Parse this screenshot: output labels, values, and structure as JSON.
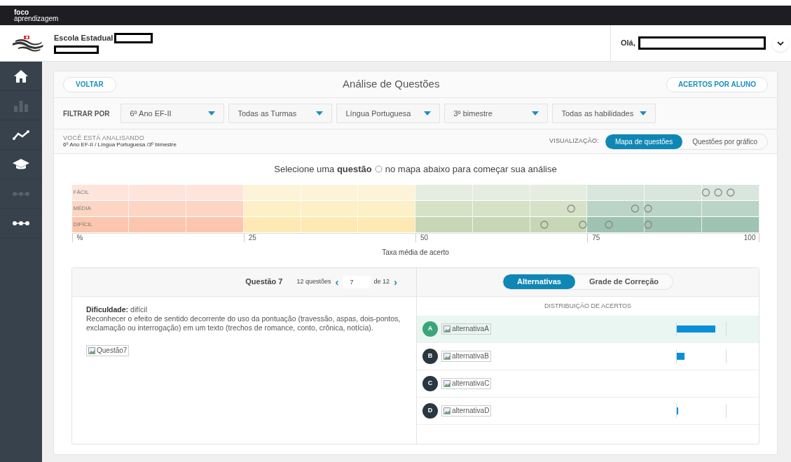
{
  "brand": {
    "line1": "foco",
    "line2": "aprendizagem"
  },
  "header": {
    "school": "Escola Estadual",
    "greeting": "Olá,"
  },
  "sidebar": {
    "items": [
      {
        "kind": "home",
        "disabled": false
      },
      {
        "kind": "bars",
        "disabled": true
      },
      {
        "kind": "trend",
        "disabled": false
      },
      {
        "kind": "cap",
        "disabled": false
      },
      {
        "kind": "dots",
        "disabled": true
      },
      {
        "kind": "dots",
        "disabled": false
      }
    ]
  },
  "card": {
    "back": "VOLTAR",
    "title": "Análise de Questões",
    "action": "ACERTOS POR ALUNO"
  },
  "filters": {
    "label": "FILTRAR POR",
    "items": [
      "6º Ano EF-II",
      "Todas as Turmas",
      "Língua Portuguesa",
      "3º bimestre",
      "Todas as habilidades"
    ]
  },
  "analysis": {
    "label": "VOCÊ ESTÁ ANALISANDO",
    "path": "6º Ano EF-II / Língua Portuguesa /3º bimestre",
    "view_label": "VISUALIZAÇÃO:",
    "views": [
      {
        "label": "Mapa de questões",
        "selected": true
      },
      {
        "label": "Questões por gráfico",
        "selected": false
      }
    ]
  },
  "map": {
    "prompt_before": "Selecione uma **questão**",
    "prompt_after": "no mapa abaixo para começar sua análise",
    "axis_title": "Taxa média de acerto",
    "ticks": [
      "%",
      "25",
      "50",
      "75",
      "100"
    ],
    "rows": [
      {
        "label": "FÁCIL",
        "markers": [
          {
            "level": 0.922
          },
          {
            "level": 0.94
          },
          {
            "level": 0.958
          }
        ]
      },
      {
        "label": "MÉDIA",
        "markers": [
          {
            "level": 0.726
          },
          {
            "level": 0.819
          },
          {
            "level": 0.838
          }
        ]
      },
      {
        "label": "DIFÍCIL",
        "markers": [
          {
            "level": 0.687
          },
          {
            "level": 0.743
          },
          {
            "level": 0.781
          },
          {
            "level": 0.838
          }
        ]
      }
    ]
  },
  "question": {
    "title": "Questão 7",
    "count": "12 questões",
    "prev": "‹",
    "current": "7",
    "total": "de 12",
    "next": "›",
    "difficulty_label": "Dificuldade:",
    "difficulty": "difícil",
    "description": "Reconhecer o efeito de sentido decorrente do uso da pontuação (travessão, aspas, dois-pontos, exclamação ou interrogação) em um texto (trechos de romance, conto, crônica, notícia).",
    "image_alt": "Questão7"
  },
  "answers": {
    "tabs": [
      {
        "label": "Alternativas",
        "selected": true
      },
      {
        "label": "Grade de Correção",
        "selected": false
      }
    ],
    "heading": "DISTRIBUIÇÃO DE ACERTOS",
    "items": [
      {
        "letter": "A",
        "image_alt": "alternativaA",
        "correct": true,
        "selected": true,
        "level": 0.78
      },
      {
        "letter": "B",
        "image_alt": "alternativaB",
        "correct": false,
        "selected": false,
        "level": 0.15
      },
      {
        "letter": "C",
        "image_alt": "alternativaC",
        "correct": false,
        "selected": false,
        "level": 0
      },
      {
        "letter": "D",
        "image_alt": "alternativaD",
        "correct": false,
        "selected": false,
        "level": 0.03
      }
    ]
  }
}
